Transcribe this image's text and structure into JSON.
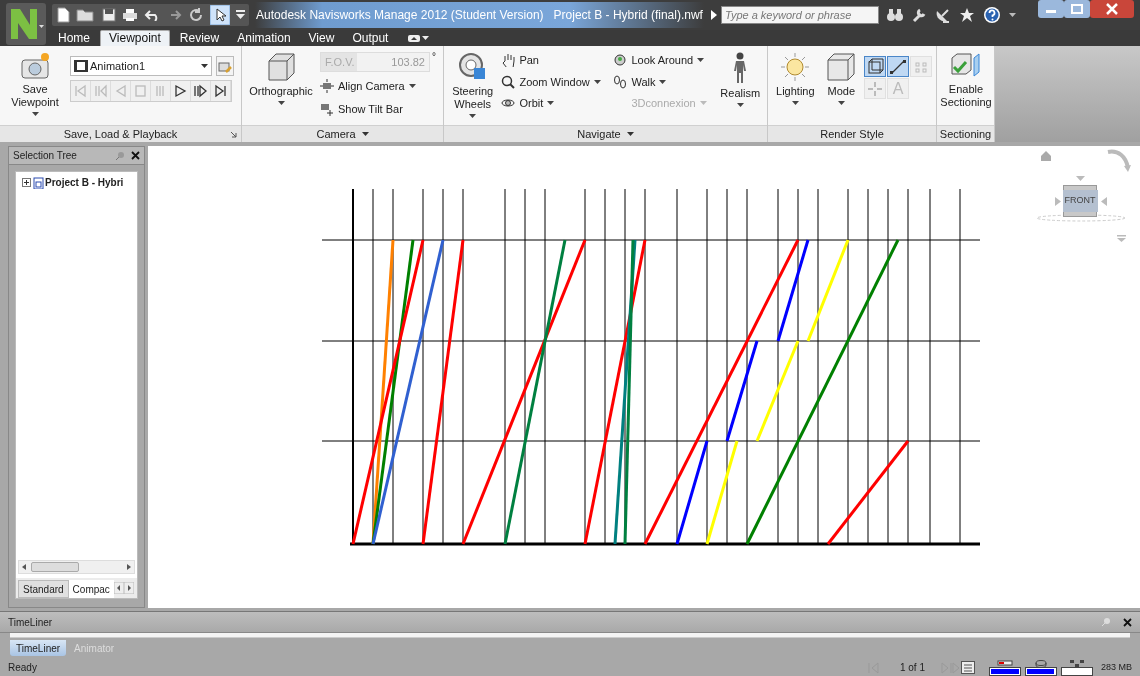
{
  "title_bar": {
    "app_title": "Autodesk Navisworks Manage 2012 (Student Version)",
    "document_title": "Project B - Hybrid (final).nwf",
    "search_placeholder": "Type a keyword or phrase"
  },
  "ribbon_tabs": [
    {
      "label": "Home",
      "selected": false
    },
    {
      "label": "Viewpoint",
      "selected": true
    },
    {
      "label": "Review",
      "selected": false
    },
    {
      "label": "Animation",
      "selected": false
    },
    {
      "label": "View",
      "selected": false
    },
    {
      "label": "Output",
      "selected": false
    }
  ],
  "ribbon": {
    "save_load_playback": {
      "title": "Save, Load & Playback",
      "save_button": "Save Viewpoint",
      "animation": "Animation1",
      "playback": [
        {
          "kind": "to-start",
          "disabled": true
        },
        {
          "kind": "step-back",
          "disabled": true
        },
        {
          "kind": "play-back",
          "disabled": true
        },
        {
          "kind": "stop",
          "disabled": true
        },
        {
          "kind": "pause",
          "disabled": true
        },
        {
          "kind": "play",
          "disabled": false
        },
        {
          "kind": "step-forward",
          "disabled": false
        },
        {
          "kind": "to-end",
          "disabled": false
        }
      ]
    },
    "camera": {
      "title": "Camera",
      "menu": true,
      "projection": "Orthographic",
      "fov_label": "F.O.V.",
      "fov_value": "103.82",
      "fov_unit": "°",
      "align": "Align Camera",
      "tilt": "Show Tilt Bar"
    },
    "navigate": {
      "title": "Navigate",
      "menu": true,
      "steering": "Steering Wheels",
      "tools": [
        {
          "kind": "pan",
          "label": "Pan",
          "disabled": false,
          "dropdown": false
        },
        {
          "kind": "look",
          "label": "Look Around",
          "disabled": false,
          "dropdown": true
        },
        {
          "kind": "zoom",
          "label": "Zoom Window",
          "disabled": false,
          "dropdown": true
        },
        {
          "kind": "walk",
          "label": "Walk",
          "disabled": false,
          "dropdown": true
        },
        {
          "kind": "orbit",
          "label": "Orbit",
          "disabled": false,
          "dropdown": true
        },
        {
          "kind": "connexion",
          "label": "3Dconnexion",
          "disabled": true,
          "dropdown": true
        }
      ],
      "realism": "Realism"
    },
    "render_style": {
      "title": "Render Style",
      "lighting": "Lighting",
      "mode": "Mode",
      "toggles": [
        {
          "kind": "solid",
          "selected": true,
          "disabled": false
        },
        {
          "kind": "wireframe",
          "selected": true,
          "disabled": false
        },
        {
          "kind": "points",
          "selected": false,
          "disabled": true
        },
        {
          "kind": "snap",
          "selected": false,
          "disabled": true
        },
        {
          "kind": "text",
          "label": "A",
          "selected": false,
          "disabled": true
        }
      ]
    },
    "sectioning": {
      "title": "Sectioning",
      "button": "Enable Sectioning"
    }
  },
  "selection_tree": {
    "title": "Selection Tree",
    "items": [
      {
        "label": "Project B - Hybri",
        "expanded": false
      }
    ],
    "tabs": [
      {
        "label": "Standard",
        "selected": false
      },
      {
        "label": "Compac",
        "selected": true
      }
    ]
  },
  "viewport": {
    "viewcube_face": "FRONT"
  },
  "timeliner": {
    "title": "TimeLiner",
    "tabs": [
      {
        "label": "TimeLiner",
        "selected": true
      },
      {
        "label": "Animator",
        "selected": false
      }
    ]
  },
  "status_bar": {
    "status": "Ready",
    "page": "1 of 1",
    "meters": [
      {
        "kind": "pencil",
        "level": 1
      },
      {
        "kind": "disk",
        "level": 0.95
      },
      {
        "kind": "network"
      }
    ],
    "memory": "283 MB"
  }
}
